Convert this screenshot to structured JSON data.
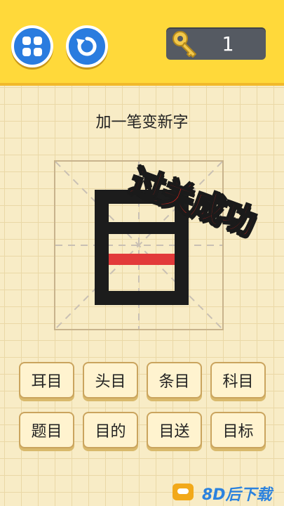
{
  "header": {
    "menu_icon": "grid-four-squares-icon",
    "undo_icon": "undo-arrow-icon",
    "key_icon": "key-icon",
    "key_count": "1"
  },
  "puzzle": {
    "title": "加一笔变新字",
    "character": "目",
    "added_stroke_color": "#e23a3a",
    "success_stamp": "过关成功"
  },
  "options": [
    "耳目",
    "头目",
    "条目",
    "科目",
    "题目",
    "目的",
    "目送",
    "目标"
  ],
  "colors": {
    "topbar": "#ffd93a",
    "button_blue": "#2a7cdf",
    "stamp_red": "#e2241c",
    "option_bg": "#fff3cf"
  },
  "watermark": {
    "text": "8D后下载"
  }
}
